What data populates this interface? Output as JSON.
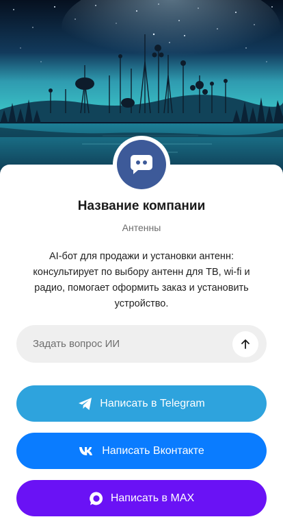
{
  "company": {
    "name": "Название компании",
    "category": "Антенны",
    "description": "AI-бот для продажи и установки антенн: консультирует по выбору антенн для ТВ, wi-fi и радио, помогает оформить заказ и установить устройство."
  },
  "ask": {
    "placeholder": "Задать вопрос ИИ",
    "send_icon": "arrow-up-icon"
  },
  "buttons": {
    "telegram": {
      "label": "Написать в Telegram",
      "icon": "telegram-icon",
      "color": "#2ea3dd"
    },
    "vk": {
      "label": "Написать Вконтакте",
      "icon": "vk-icon",
      "color": "#0a7cff"
    },
    "max": {
      "label": "Написать в MAX",
      "icon": "max-icon",
      "color": "#6a12f5"
    }
  },
  "colors": {
    "avatar_bg": "#3d5a99",
    "ask_bg": "#efefef"
  }
}
